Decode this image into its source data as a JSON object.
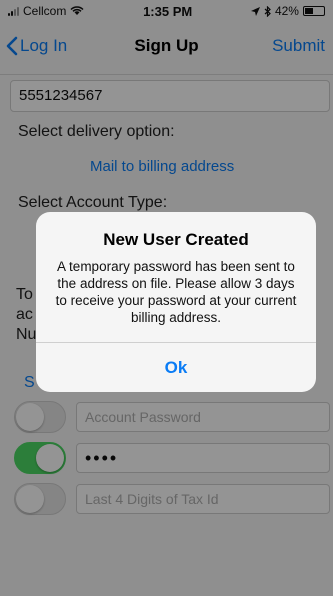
{
  "status": {
    "carrier": "Cellcom",
    "time": "1:35 PM",
    "battery": "42%",
    "battery_level": 0.42
  },
  "nav": {
    "back_label": "Log In",
    "title": "Sign Up",
    "submit_label": "Submit"
  },
  "form": {
    "phone_value": "5551234567",
    "delivery_label": "Select delivery option:",
    "delivery_option": "Mail to billing address",
    "account_type_label": "Select Account Type:",
    "partial_lines": [
      "To",
      "ac",
      "Nu"
    ],
    "partial_link": "S",
    "fields": [
      {
        "placeholder": "Account Password",
        "value": "",
        "toggle_on": false
      },
      {
        "placeholder": "",
        "value": "••••",
        "toggle_on": true
      },
      {
        "placeholder": "Last 4 Digits of Tax Id",
        "value": "",
        "toggle_on": false
      }
    ]
  },
  "alert": {
    "title": "New User Created",
    "message": "A temporary password has been sent to the address on file. Please allow 3 days to receive your password at your current billing address.",
    "button_label": "Ok"
  },
  "colors": {
    "accent": "#0a7cf5",
    "toggle_on": "#4cd964"
  }
}
